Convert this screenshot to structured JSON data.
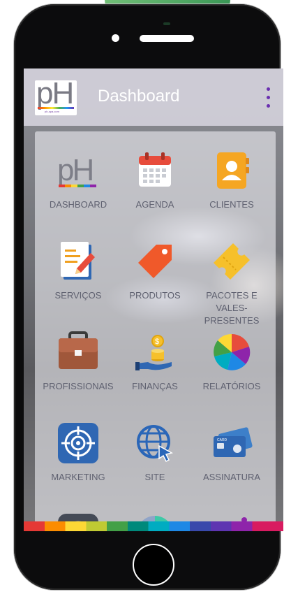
{
  "app": {
    "logo_text": "pH",
    "logo_sub": "ph-spa.com",
    "title": "Dashboard"
  },
  "menu": [
    {
      "label": "DASHBOARD",
      "icon": "ph-logo-icon"
    },
    {
      "label": "AGENDA",
      "icon": "calendar-icon"
    },
    {
      "label": "CLIENTES",
      "icon": "contacts-book-icon"
    },
    {
      "label": "SERVIÇOS",
      "icon": "document-pencil-icon"
    },
    {
      "label": "PRODUTOS",
      "icon": "price-tag-icon"
    },
    {
      "label": "PACOTES E VALES-PRESENTES",
      "icon": "ticket-icon"
    },
    {
      "label": "PROFISSIONAIS",
      "icon": "briefcase-icon"
    },
    {
      "label": "FINANÇAS",
      "icon": "coins-hand-icon"
    },
    {
      "label": "RELATÓRIOS",
      "icon": "pie-chart-icon"
    },
    {
      "label": "MARKETING",
      "icon": "target-icon"
    },
    {
      "label": "SITE",
      "icon": "globe-icon"
    },
    {
      "label": "ASSINATURA",
      "icon": "credit-card-icon"
    }
  ],
  "card": {
    "brand_text": "CARD"
  },
  "colors": {
    "accent": "#6a2fb0",
    "label": "#5f6170",
    "calendar": "#e74c3c",
    "contacts": "#f5a623",
    "tag": "#f0592a",
    "ticket": "#f6c02b",
    "briefcase": "#a0573a",
    "marketing": "#2f67b3",
    "globe": "#2a66b8"
  }
}
